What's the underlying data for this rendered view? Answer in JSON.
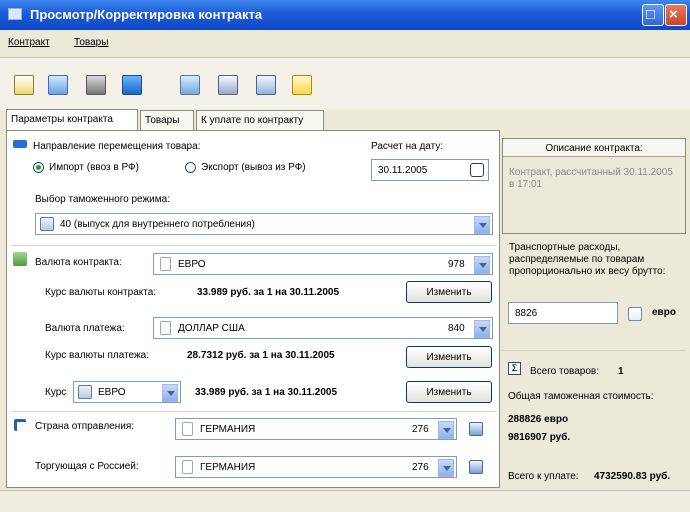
{
  "window": {
    "title": "Просмотр/Корректировка контракта"
  },
  "menu": [
    "Контракт",
    "Товары"
  ],
  "tabs": [
    "Параметры контракта",
    "Товары",
    "К уплате по контракту"
  ],
  "direction": {
    "label": "Направление перемещения товара:",
    "import_label": "Импорт (ввоз в РФ)",
    "export_label": "Экспорт (вывоз из РФ)",
    "selected": "import"
  },
  "date": {
    "label": "Расчет на дату:",
    "value": "30.11.2005"
  },
  "customs_regime": {
    "label": "Выбор таможенного режима:",
    "value": "40 (выпуск для внутреннего потребления)"
  },
  "contract_currency": {
    "label": "Валюта контракта:",
    "name": "ЕВРО",
    "code": "978",
    "rate_label": "Курс валюты контракта:",
    "rate_value": "33.989 руб. за 1 на 30.11.2005",
    "change": "Изменить"
  },
  "payment_currency": {
    "label": "Валюта платежа:",
    "name": "ДОЛЛАР США",
    "code": "840",
    "rate_label": "Курс валюты платежа:",
    "rate_value": "28.7312 руб. за 1 на 30.11.2005",
    "change": "Изменить"
  },
  "rate": {
    "label": "Курс",
    "currency": "ЕВРО",
    "value": "33.989 руб. за 1 на 30.11.2005",
    "change": "Изменить"
  },
  "country_from": {
    "label": "Страна отправления:",
    "name": "ГЕРМАНИЯ",
    "code": "276"
  },
  "trade_country": {
    "label": "Торгующая с Россией:",
    "name": "ГЕРМАНИЯ",
    "code": "276"
  },
  "description": {
    "header": "Описание контракта:",
    "text": "Контракт, рассчитанный 30.11.2005 в 17:01"
  },
  "transport": {
    "label": "Транспортные расходы, распределяемые по товарам пропорционально их весу брутто:",
    "value": "8826",
    "unit": "евро"
  },
  "totals": {
    "goods_label": "Всего товаров:",
    "goods_count": "1",
    "customs_label": "Общая таможенная стоимость:",
    "customs_eur": "288826 евро",
    "customs_rub": "9816907 руб.",
    "payable_label": "Всего к уплате:",
    "payable_value": "4732590.83 руб."
  }
}
